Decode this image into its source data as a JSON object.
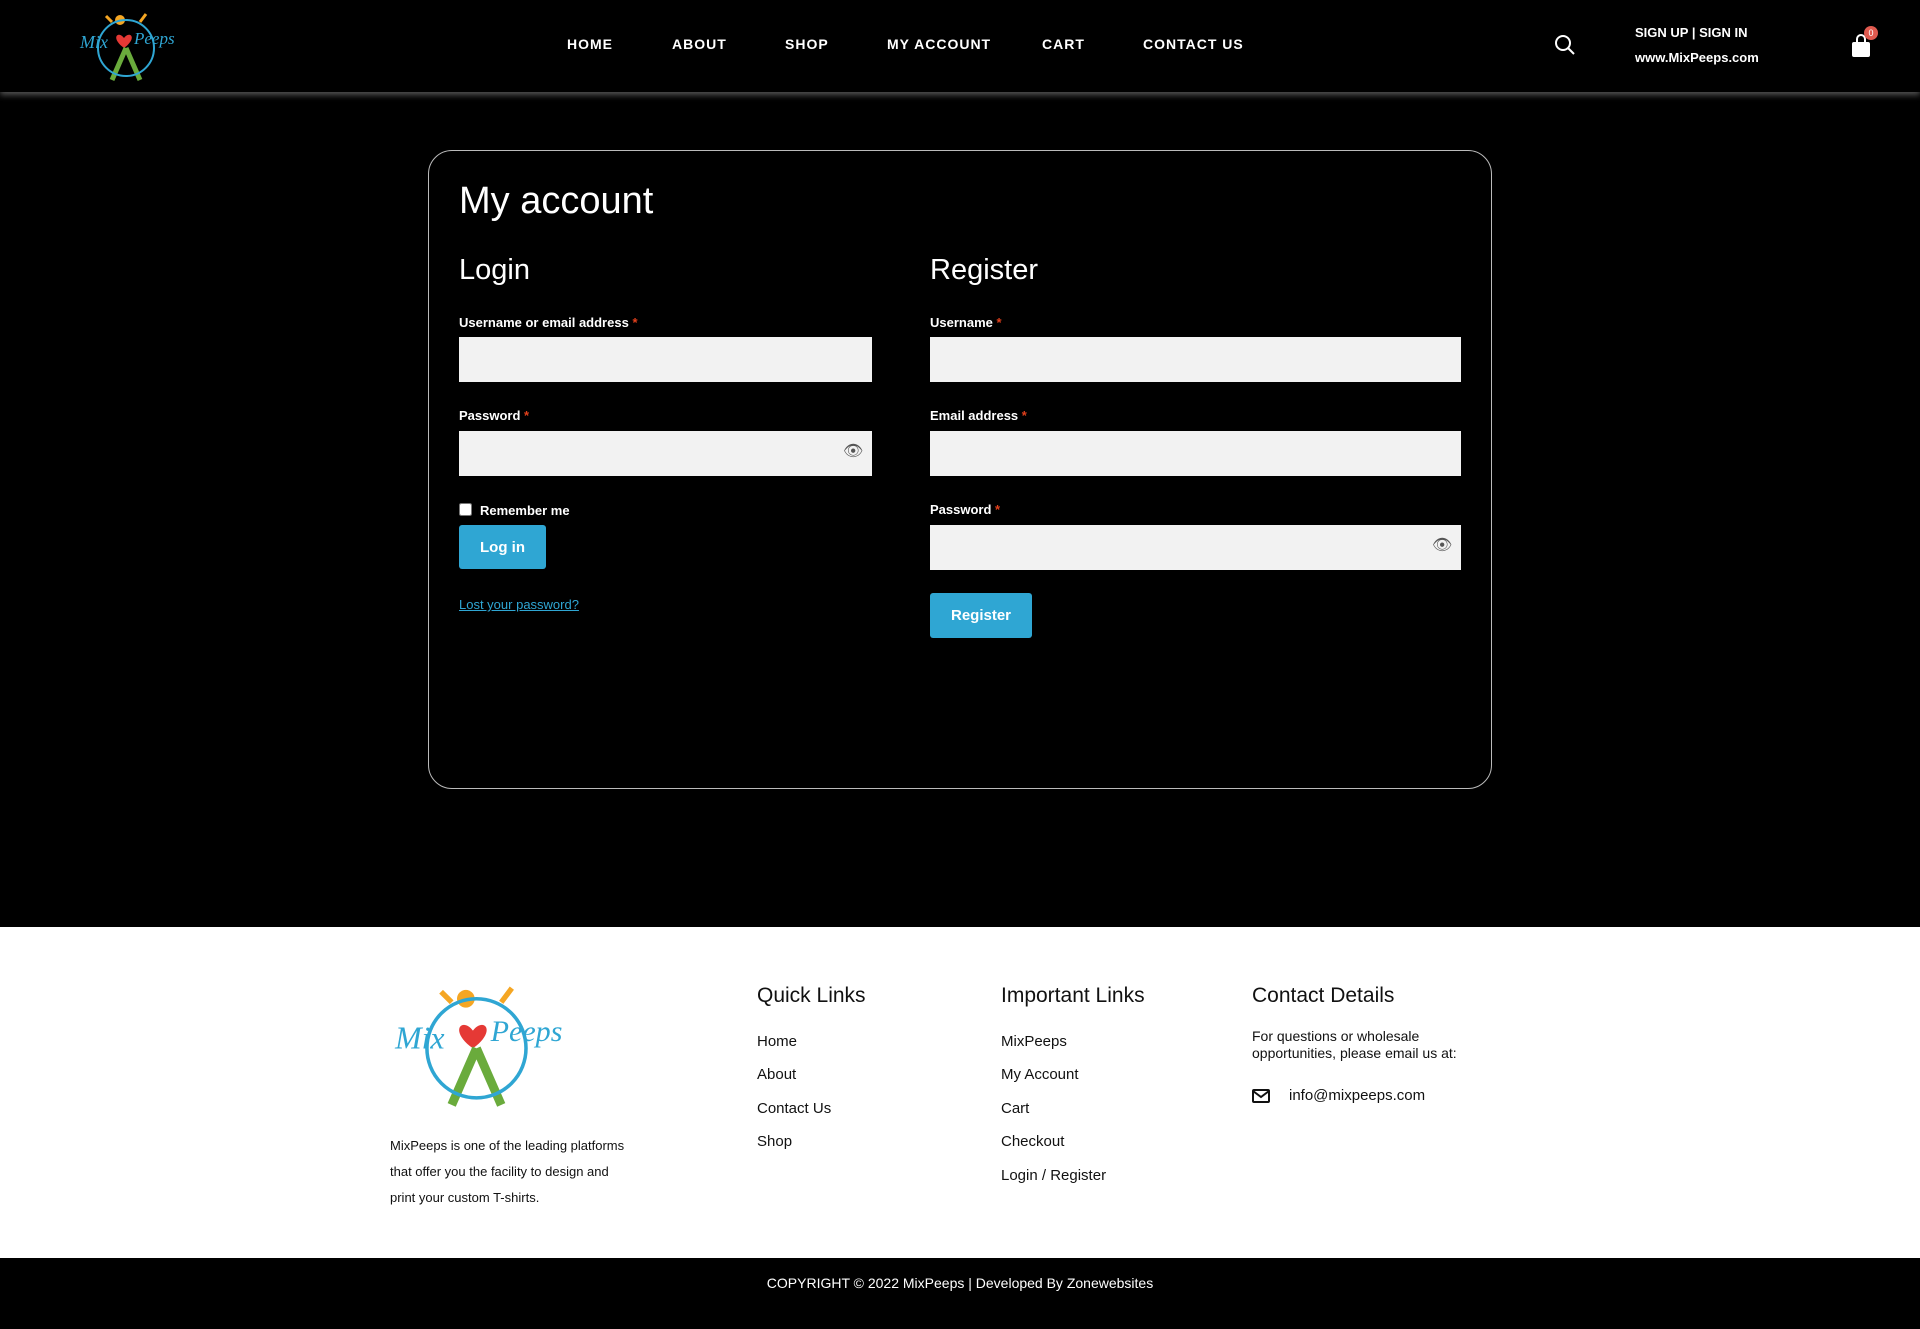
{
  "header": {
    "logo_text": "MixPeeps",
    "nav": [
      "HOME",
      "ABOUT",
      "SHOP",
      "MY ACCOUNT",
      "CART",
      "CONTACT US"
    ],
    "search_icon": "search-icon",
    "signup_signin": "SIGN UP | SIGN IN",
    "site_url": "www.MixPeeps.com",
    "cart_count": "0",
    "cart_icon": "shopping-bag-icon"
  },
  "main": {
    "title": "My account",
    "login": {
      "heading": "Login",
      "username_label": "Username or email address",
      "password_label": "Password",
      "required_mark": "*",
      "remember_label": "Remember me",
      "remember_checked": false,
      "submit": "Log in",
      "lost_password": "Lost your password?"
    },
    "register": {
      "heading": "Register",
      "username_label": "Username",
      "email_label": "Email address",
      "password_label": "Password",
      "required_mark": "*",
      "submit": "Register"
    }
  },
  "footer": {
    "about_text": [
      "MixPeeps is one of the leading platforms",
      "that offer you the facility to design and",
      "print your custom T-shirts."
    ],
    "quick_links": {
      "heading": "Quick Links",
      "items": [
        "Home",
        "About",
        "Contact Us",
        "Shop"
      ]
    },
    "important_links": {
      "heading": "Important Links",
      "items": [
        "MixPeeps",
        "My Account",
        "Cart",
        "Checkout",
        "Login / Register"
      ]
    },
    "contact": {
      "heading": "Contact Details",
      "text_lines": [
        "For questions or wholesale",
        "opportunities, please email us at:"
      ],
      "email": "info@mixpeeps.com",
      "email_icon": "envelope-icon"
    },
    "copyright": "COPYRIGHT © 2022 MixPeeps | Developed By Zonewebsites"
  },
  "colors": {
    "accent": "#2fa6d3",
    "required": "#e2401c",
    "badge": "#e05a4f"
  }
}
